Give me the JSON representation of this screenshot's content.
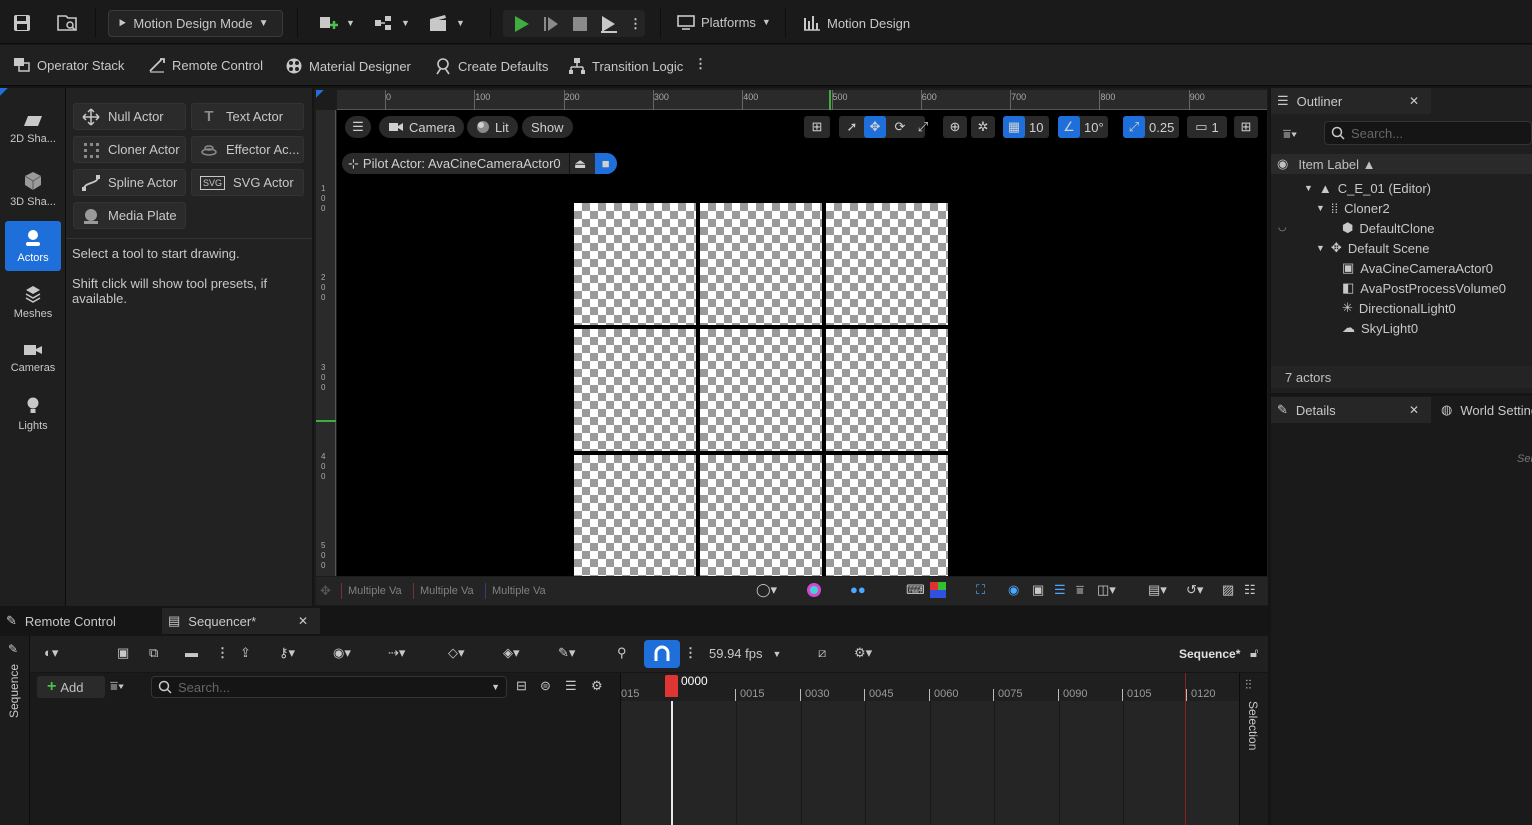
{
  "top_toolbar": {
    "mode_label": "Motion Design Mode",
    "platforms_label": "Platforms",
    "motion_design_label": "Motion Design",
    "icons": [
      "save-icon",
      "browse-icon",
      "add-actor-icon",
      "blueprint-icon",
      "cinematics-icon",
      "play-icon",
      "step-icon",
      "stop-icon",
      "eject-icon",
      "more-icon"
    ]
  },
  "secondary_toolbar": {
    "items": [
      {
        "label": "Operator Stack",
        "icon": "stack-icon"
      },
      {
        "label": "Remote Control",
        "icon": "remote-icon"
      },
      {
        "label": "Material Designer",
        "icon": "material-icon"
      },
      {
        "label": "Create Defaults",
        "icon": "defaults-icon"
      },
      {
        "label": "Transition Logic",
        "icon": "logic-icon"
      }
    ]
  },
  "modes": [
    {
      "label": "2D Sha...",
      "icon": "shape-2d-icon"
    },
    {
      "label": "3D Sha...",
      "icon": "shape-3d-icon"
    },
    {
      "label": "Actors",
      "icon": "actors-icon",
      "active": true
    },
    {
      "label": "Meshes",
      "icon": "meshes-icon"
    },
    {
      "label": "Cameras",
      "icon": "camera-icon"
    },
    {
      "label": "Lights",
      "icon": "light-icon"
    }
  ],
  "palette": {
    "buttons": [
      "Null Actor",
      "Text Actor",
      "Cloner Actor",
      "Effector Ac...",
      "Spline Actor",
      "SVG Actor",
      "Media Plate"
    ],
    "hint1": "Select a tool to start drawing.",
    "hint2": "Shift click will show tool presets, if available."
  },
  "viewport": {
    "camera_label": "Camera",
    "lit_label": "Lit",
    "show_label": "Show",
    "pilot_label": "Pilot Actor: AvaCineCameraActor0",
    "grid_snap": "10",
    "rot_snap": "10°",
    "scale_snap": "0.25",
    "camera_speed": "1",
    "ruler_top": [
      "0",
      "100",
      "200",
      "300",
      "400",
      "500",
      "600",
      "700",
      "800",
      "900"
    ],
    "ruler_left": [
      "1\n0\n0",
      "2\n0\n0",
      "3\n0\n0",
      "4\n0\n0",
      "5\n0\n0"
    ],
    "multi_values": [
      "Multiple Va",
      "Multiple Va",
      "Multiple Va"
    ]
  },
  "outliner": {
    "tab_label": "Outliner",
    "search_placeholder": "Search...",
    "column_label": "Item Label ▲",
    "items": [
      {
        "label": "C_E_01 (Editor)",
        "icon": "level-icon"
      },
      {
        "label": "Cloner2",
        "icon": "cloner-icon"
      },
      {
        "label": "DefaultClone",
        "icon": "mesh-icon"
      },
      {
        "label": "Default Scene",
        "icon": "scene-icon"
      },
      {
        "label": "AvaCineCameraActor0",
        "icon": "camera-actor-icon"
      },
      {
        "label": "AvaPostProcessVolume0",
        "icon": "volume-icon"
      },
      {
        "label": "DirectionalLight0",
        "icon": "sun-icon"
      },
      {
        "label": "SkyLight0",
        "icon": "skylight-icon"
      }
    ],
    "count": "7 actors"
  },
  "details": {
    "tab_label": "Details",
    "world_tab_label": "World Settings",
    "hint": "Sel"
  },
  "sequencer": {
    "tabs": [
      "Remote Control",
      "Sequencer*"
    ],
    "fps": "59.94 fps",
    "sequence_name": "Sequence*",
    "add_label": "Add",
    "search_placeholder": "Search...",
    "side_label": "Sequence",
    "right_label": "Selection",
    "current_frame": "0000",
    "time_ticks": [
      "015",
      "0015",
      "0030",
      "0045",
      "0060",
      "0075",
      "0090",
      "0105",
      "0120"
    ]
  }
}
